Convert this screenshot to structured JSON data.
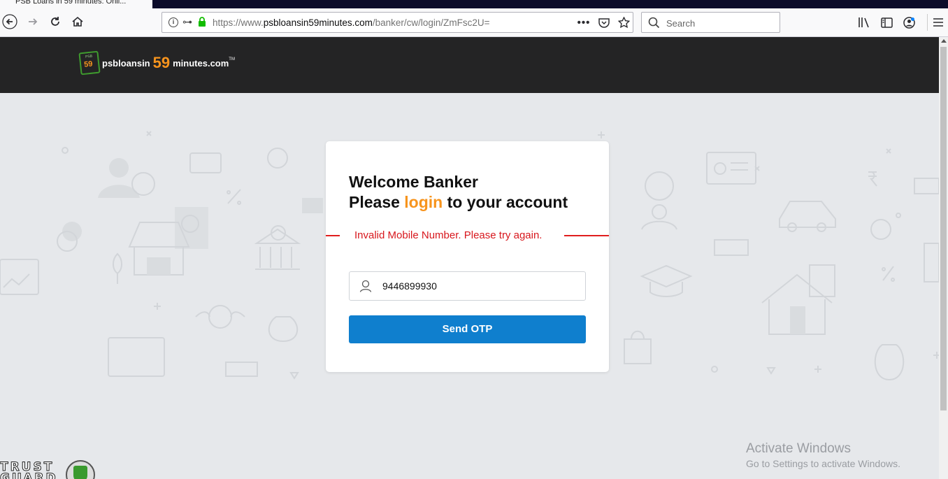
{
  "browser": {
    "tab_title": "PSB Loans in 59 minutes: Onli...",
    "url_prefix": "https://www.",
    "url_host": "psbloansin59minutes.com",
    "url_path": "/banker/cw/login/ZmFsc2U=",
    "search_placeholder": "Search",
    "page_actions_label": "•••"
  },
  "header": {
    "logo_badge": "59",
    "logo_badge_small": "PSB",
    "logo_part1": "psbloansin",
    "logo_part2": "59",
    "logo_part3": "minutes.com",
    "logo_tm": "TM"
  },
  "login": {
    "welcome": "Welcome Banker",
    "please": "Please",
    "login_word": "login",
    "account": "to your account",
    "error": "Invalid Mobile Number. Please try again.",
    "mobile_value": "9446899930",
    "send_otp": "Send OTP"
  },
  "watermark": {
    "title": "Activate Windows",
    "subtitle": "Go to Settings to activate Windows."
  },
  "trust_guard": {
    "text": "TRUST GUARD"
  },
  "colors": {
    "accent_orange": "#f7941d",
    "button_blue": "#0f7fce",
    "error_red": "#d8171d",
    "header_dark": "#242425"
  }
}
